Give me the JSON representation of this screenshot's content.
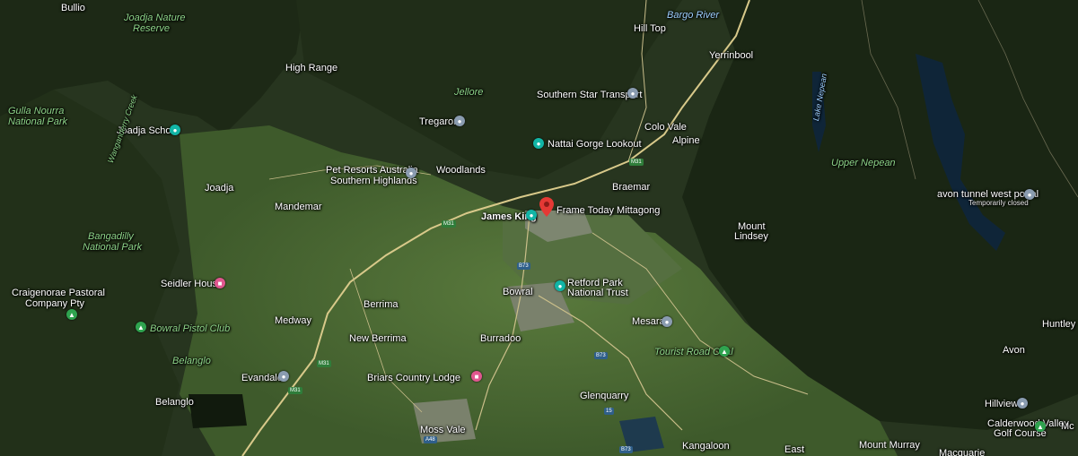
{
  "map": {
    "type": "satellite",
    "colors": {
      "forest_dark": "#1e2a17",
      "farmland": "#4c6a34",
      "road": "#d8c98a",
      "water": "#10283e",
      "selected_pin": "#e53935"
    }
  },
  "labels": {
    "bullio": "Bullio",
    "joadja_nature_reserve_1": "Joadja Nature",
    "joadja_nature_reserve_2": "Reserve",
    "high_range": "High Range",
    "gulla_1": "Gulla Nourra",
    "gulla_2": "National Park",
    "joadja_school": "Joadja School",
    "wanganderry": "Wanganderry Creek",
    "joadja": "Joadja",
    "mandemar": "Mandemar",
    "bangadilly_1": "Bangadilly",
    "bangadilly_2": "National Park",
    "seidler_house": "Seidler House",
    "craigenrae_1": "Craigenorae Pastoral",
    "craigenrae_2": "Company Pty",
    "bowral_pistol": "Bowral Pistol Club",
    "medway": "Medway",
    "berrima": "Berrima",
    "new_berrima": "New Berrima",
    "belanglo_creek": "Belanglo",
    "evandale": "Evandale",
    "belanglo": "Belanglo",
    "jellore": "Jellore",
    "tregaron": "Tregaron",
    "pet_resorts_1": "Pet Resorts Australia",
    "pet_resorts_2": "Southern Highlands",
    "woodlands": "Woodlands",
    "james_king": "James King",
    "frame_today": "Frame Today Mittagong",
    "bowral": "Bowral",
    "retford_1": "Retford Park",
    "retford_2": "National Trust",
    "burradoo": "Burradoo",
    "briars": "Briars Country Lodge",
    "moss_vale": "Moss Vale",
    "glenquarry": "Glenquarry",
    "kangaloon": "Kangaloon",
    "east": "East",
    "mount_murray": "Mount Murray",
    "macquarie": "Macquarie",
    "hill_top": "Hill Top",
    "bargo_river": "Bargo River",
    "yerrinbool": "Yerrinbool",
    "southern_star": "Southern Star Transport",
    "colo_vale": "Colo Vale",
    "nattai": "Nattai Gorge Lookout",
    "alpine": "Alpine",
    "braemar": "Braemar",
    "mount_lindsey_1": "Mount",
    "mount_lindsey_2": "Lindsey",
    "mesarai": "Mesarai",
    "tourist_road_oval": "Tourist Road Oval",
    "lake_nepean": "Lake Nepean",
    "upper_nepean": "Upper Nepean",
    "avon_tunnel": "avon tunnel west portal",
    "temporarily_closed": "Temporarily closed",
    "huntley": "Huntley",
    "avon": "Avon",
    "hillview": "Hillview",
    "calderwood_1": "Calderwood Valley",
    "calderwood_2": "Golf Course",
    "mc": "Mc"
  },
  "shields": {
    "m31_a": "M31",
    "m31_b": "M31",
    "m31_c": "M31",
    "m31_d": "M31",
    "b73_a": "B73",
    "b73_b": "B73",
    "b73_c": "B73",
    "a48": "A48",
    "r15": "15"
  },
  "icons": {
    "place": "place-pin-icon",
    "attraction": "camera-icon",
    "lodging": "bed-icon",
    "park": "tree-icon",
    "selected": "red-location-marker-icon"
  }
}
